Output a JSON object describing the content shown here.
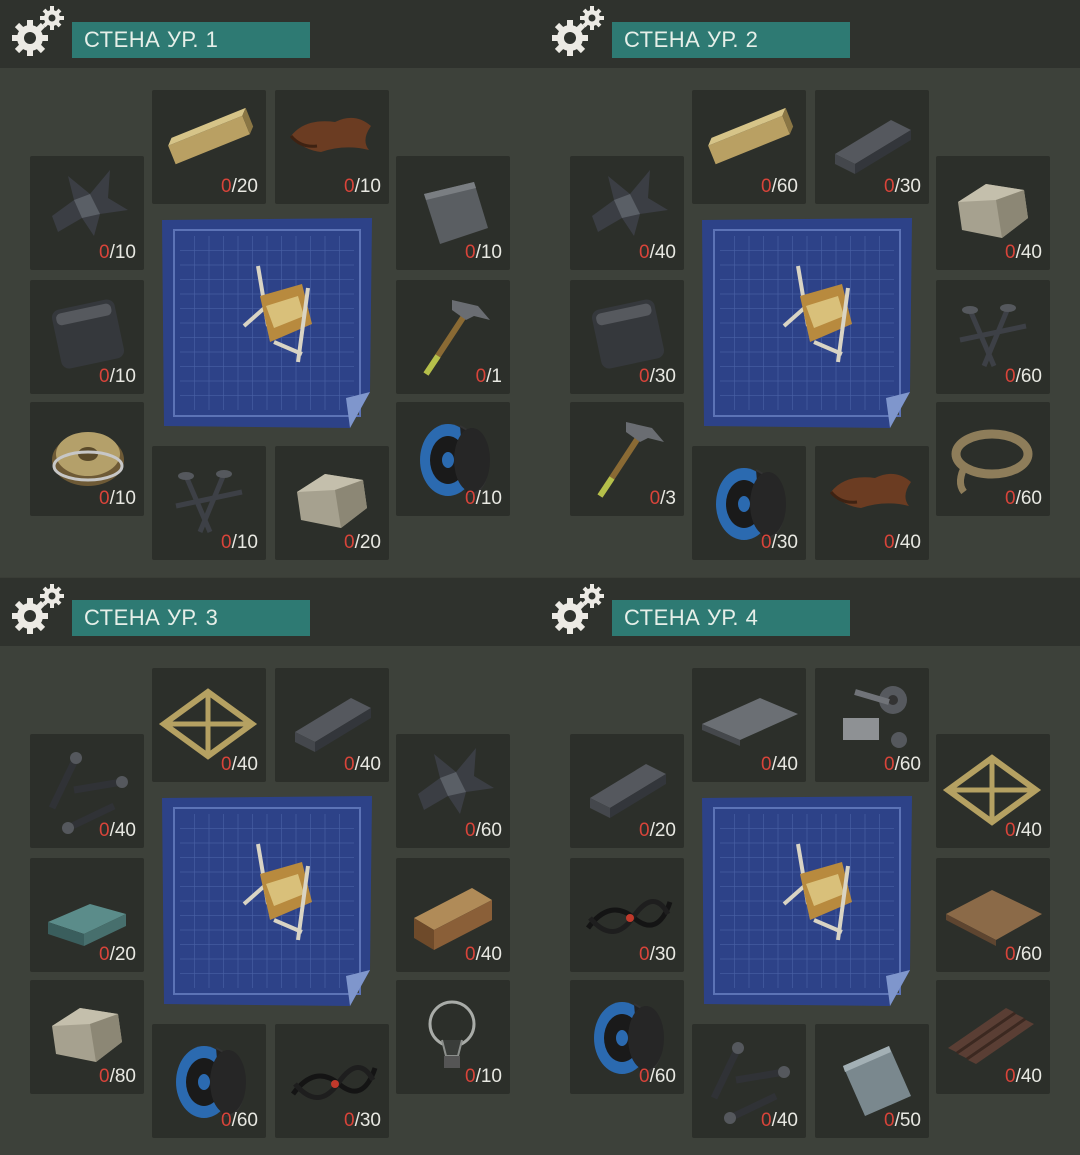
{
  "panels": [
    {
      "title": "СТЕНА УР. 1",
      "slots": [
        {
          "icon": "plank-icon",
          "have": "0",
          "need": "/20"
        },
        {
          "icon": "leather-icon",
          "have": "0",
          "need": "/10"
        },
        {
          "icon": "scrap-metal-icon",
          "have": "0",
          "need": "/10"
        },
        {
          "icon": "metal-sheet-icon",
          "have": "0",
          "need": "/10"
        },
        {
          "icon": "metal-plate-icon",
          "have": "0",
          "need": "/10"
        },
        {
          "icon": "hammer-icon",
          "have": "0",
          "need": "/1"
        },
        {
          "icon": "wire-spool-icon",
          "have": "0",
          "need": "/10"
        },
        {
          "icon": "cable-spool-icon",
          "have": "0",
          "need": "/10"
        },
        {
          "icon": "nails-icon",
          "have": "0",
          "need": "/10"
        },
        {
          "icon": "stone-icon",
          "have": "0",
          "need": "/20"
        }
      ]
    },
    {
      "title": "СТЕНА УР. 2",
      "slots": [
        {
          "icon": "plank-icon",
          "have": "0",
          "need": "/60"
        },
        {
          "icon": "metal-bar-icon",
          "have": "0",
          "need": "/30"
        },
        {
          "icon": "scrap-metal-icon",
          "have": "0",
          "need": "/40"
        },
        {
          "icon": "stone-icon",
          "have": "0",
          "need": "/40"
        },
        {
          "icon": "metal-plate-icon",
          "have": "0",
          "need": "/30"
        },
        {
          "icon": "nails-icon",
          "have": "0",
          "need": "/60"
        },
        {
          "icon": "hammer-icon",
          "have": "0",
          "need": "/3"
        },
        {
          "icon": "rope-icon",
          "have": "0",
          "need": "/60"
        },
        {
          "icon": "cable-spool-icon",
          "have": "0",
          "need": "/30"
        },
        {
          "icon": "leather-icon",
          "have": "0",
          "need": "/40"
        }
      ]
    },
    {
      "title": "СТЕНА УР. 3",
      "slots": [
        {
          "icon": "wood-frame-icon",
          "have": "0",
          "need": "/40"
        },
        {
          "icon": "metal-bar-icon",
          "have": "0",
          "need": "/40"
        },
        {
          "icon": "screws-icon",
          "have": "0",
          "need": "/40"
        },
        {
          "icon": "scrap-metal-icon",
          "have": "0",
          "need": "/60"
        },
        {
          "icon": "ingot-icon",
          "have": "0",
          "need": "/20"
        },
        {
          "icon": "wood-beam-icon",
          "have": "0",
          "need": "/40"
        },
        {
          "icon": "stone-icon",
          "have": "0",
          "need": "/80"
        },
        {
          "icon": "light-bulb-icon",
          "have": "0",
          "need": "/10"
        },
        {
          "icon": "cable-spool-icon",
          "have": "0",
          "need": "/60"
        },
        {
          "icon": "wires-icon",
          "have": "0",
          "need": "/30"
        }
      ]
    },
    {
      "title": "СТЕНА УР. 4",
      "slots": [
        {
          "icon": "steel-plate-icon",
          "have": "0",
          "need": "/40"
        },
        {
          "icon": "mechanical-parts-icon",
          "have": "0",
          "need": "/60"
        },
        {
          "icon": "metal-bar-icon",
          "have": "0",
          "need": "/20"
        },
        {
          "icon": "wood-frame-icon",
          "have": "0",
          "need": "/40"
        },
        {
          "icon": "wires-icon",
          "have": "0",
          "need": "/30"
        },
        {
          "icon": "chipboard-icon",
          "have": "0",
          "need": "/60"
        },
        {
          "icon": "cable-spool-icon",
          "have": "0",
          "need": "/60"
        },
        {
          "icon": "corrugated-sheet-icon",
          "have": "0",
          "need": "/40"
        },
        {
          "icon": "screws-icon",
          "have": "0",
          "need": "/40"
        },
        {
          "icon": "glass-plate-icon",
          "have": "0",
          "need": "/50"
        }
      ]
    }
  ]
}
